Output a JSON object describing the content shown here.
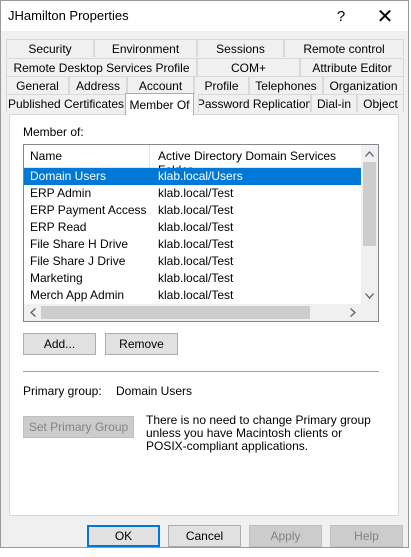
{
  "window": {
    "title": "JHamilton Properties",
    "help_glyph": "?",
    "close_glyph": "✕"
  },
  "tabs": {
    "row1": [
      "Security",
      "Environment",
      "Sessions",
      "Remote control"
    ],
    "row2": [
      "Remote Desktop Services Profile",
      "COM+",
      "Attribute Editor"
    ],
    "row3": [
      "General",
      "Address",
      "Account",
      "Profile",
      "Telephones",
      "Organization"
    ],
    "row4": [
      "Published Certificates",
      "Member Of",
      "Password Replication",
      "Dial-in",
      "Object"
    ],
    "active": "Member Of"
  },
  "member_of": {
    "label": "Member of:",
    "columns": [
      "Name",
      "Active Directory Domain Services Folder"
    ],
    "rows": [
      {
        "name": "Domain Users",
        "folder": "klab.local/Users",
        "selected": true
      },
      {
        "name": "ERP Admin",
        "folder": "klab.local/Test"
      },
      {
        "name": "ERP Payment Access",
        "folder": "klab.local/Test"
      },
      {
        "name": "ERP Read",
        "folder": "klab.local/Test"
      },
      {
        "name": "File Share H Drive",
        "folder": "klab.local/Test"
      },
      {
        "name": "File Share J Drive",
        "folder": "klab.local/Test"
      },
      {
        "name": "Marketing",
        "folder": "klab.local/Test"
      },
      {
        "name": "Merch App Admin",
        "folder": "klab.local/Test"
      }
    ],
    "add_label": "Add...",
    "remove_label": "Remove"
  },
  "primary_group": {
    "label": "Primary group:",
    "value": "Domain Users",
    "set_button": "Set Primary Group",
    "note": "There is no need to change Primary group unless you have Macintosh clients or POSIX-compliant applications."
  },
  "footer": {
    "ok": "OK",
    "cancel": "Cancel",
    "apply": "Apply",
    "help": "Help"
  },
  "colors": {
    "selection": "#0078d7",
    "dialog_bg": "#f0f0f0",
    "default_button_border": "#0078d7"
  }
}
